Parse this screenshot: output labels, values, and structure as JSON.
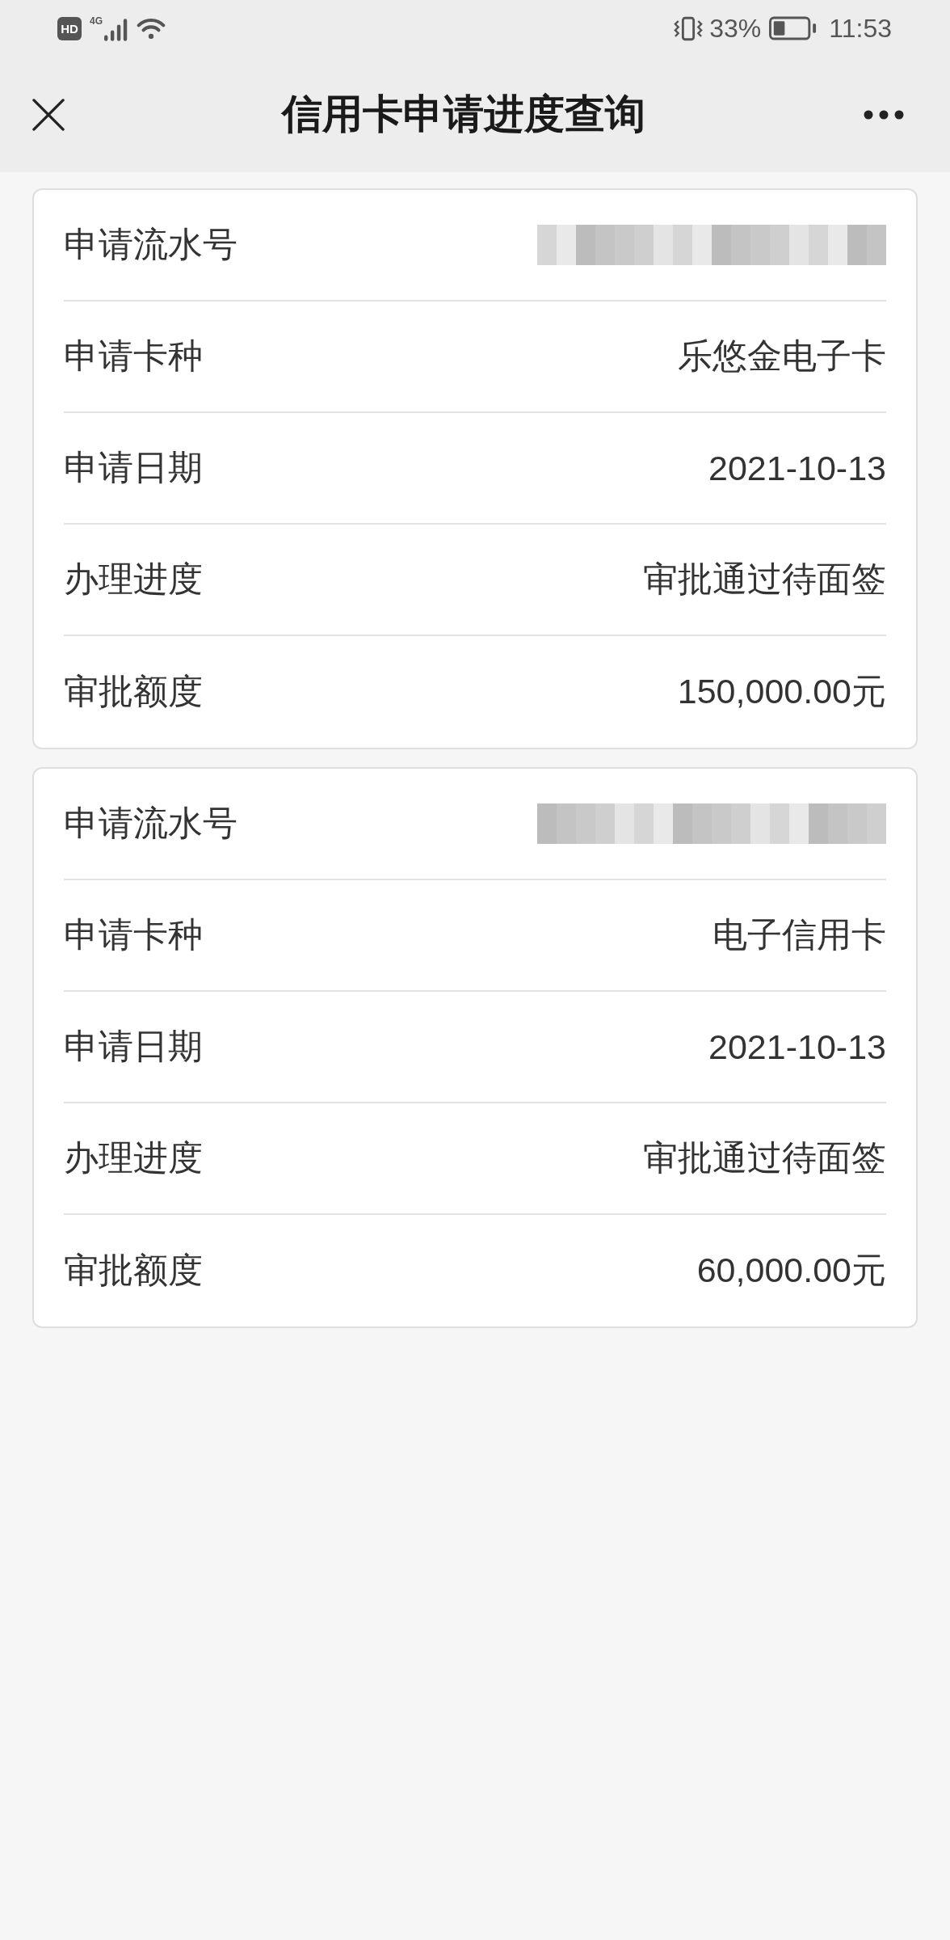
{
  "status_bar": {
    "hd_badge": "HD",
    "network_type": "4G",
    "battery_percent": "33%",
    "time": "11:53"
  },
  "header": {
    "title": "信用卡申请进度查询"
  },
  "applications": [
    {
      "rows": [
        {
          "kind": "redacted",
          "label": "申请流水号"
        },
        {
          "kind": "text",
          "label": "申请卡种",
          "value": "乐悠金电子卡"
        },
        {
          "kind": "text",
          "label": "申请日期",
          "value": "2021-10-13"
        },
        {
          "kind": "text",
          "label": "办理进度",
          "value": "审批通过待面签"
        },
        {
          "kind": "text",
          "label": "审批额度",
          "value": "150,000.00元"
        }
      ]
    },
    {
      "rows": [
        {
          "kind": "redacted",
          "label": "申请流水号"
        },
        {
          "kind": "text",
          "label": "申请卡种",
          "value": "电子信用卡"
        },
        {
          "kind": "text",
          "label": "申请日期",
          "value": "2021-10-13"
        },
        {
          "kind": "text",
          "label": "办理进度",
          "value": "审批通过待面签"
        },
        {
          "kind": "text",
          "label": "审批额度",
          "value": "60,000.00元"
        }
      ]
    }
  ]
}
